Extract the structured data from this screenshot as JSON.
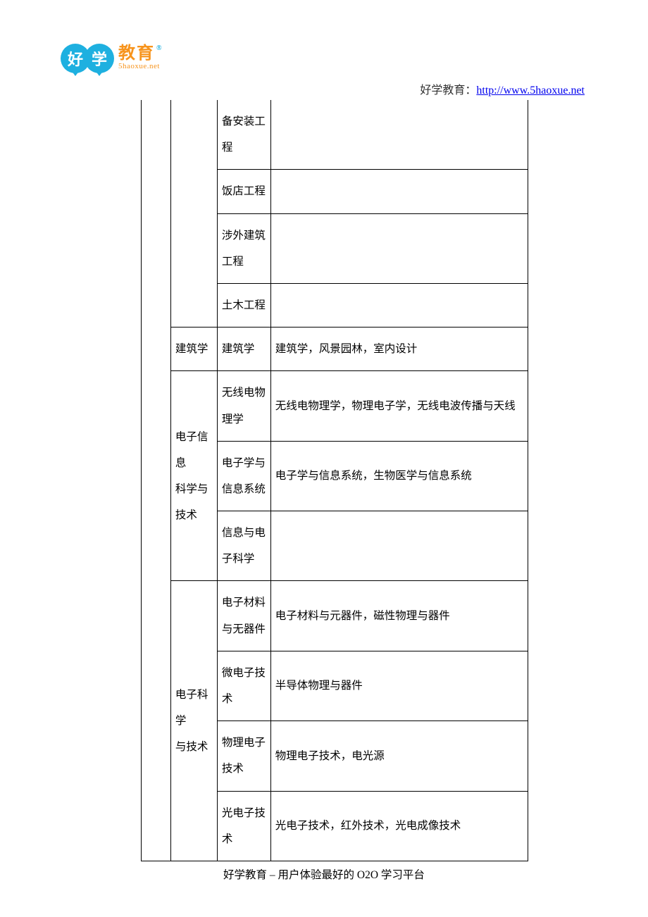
{
  "logo": {
    "char1": "好",
    "char2": "学",
    "edu_main": "教育",
    "reg": "®",
    "edu_sub": "5haoxue.net"
  },
  "header": {
    "label": "好学教育：",
    "url": "http://www.5haoxue.net"
  },
  "table": {
    "rows": [
      {
        "c3": "备安装工程",
        "c4": "",
        "c3_cont": true
      },
      {
        "c3": "饭店工程",
        "c4": ""
      },
      {
        "c3": "涉外建筑工程",
        "c4": ""
      },
      {
        "c3": "土木工程",
        "c4": ""
      },
      {
        "c2": "建筑学",
        "c3": "建筑学",
        "c4": "建筑学，风景园林，室内设计"
      },
      {
        "c2": "电子信息\n科学与\n技术",
        "c2_rowspan": 3,
        "c3": "无线电物理学",
        "c4": "无线电物理学，物理电子学，无线电波传播与天线"
      },
      {
        "c3": "电子学与信息系统",
        "c4": "电子学与信息系统，生物医学与信息系统"
      },
      {
        "c3": "信息与电子科学",
        "c4": ""
      },
      {
        "c2": "电子科学\n与技术",
        "c2_rowspan": 4,
        "c3": "电子材料与无器件",
        "c4": "电子材料与元器件，磁性物理与器件"
      },
      {
        "c3": "微电子技术",
        "c4": "半导体物理与器件"
      },
      {
        "c3": "物理电子技术",
        "c4": "物理电子技术，电光源"
      },
      {
        "c3": "光电子技术",
        "c4": "光电子技术，红外技术，光电成像技术"
      }
    ],
    "col2_group1": "电子信息\n科学与技术",
    "col2_group1_l1": "电子信",
    "col2_group1_l2": "息",
    "col2_group1_l3": "科学与",
    "col2_group1_l4": "技术",
    "col2_group2_l1": "电子科",
    "col2_group2_l2": "学",
    "col2_group2_l3": "与技术",
    "r1_c3": "备安装工程",
    "r2_c3": "饭店工程",
    "r3_c3": "涉外建筑工程",
    "r4_c3": "土木工程",
    "r5_c2": "建筑学",
    "r5_c3": "建筑学",
    "r5_c4": "建筑学，风景园林，室内设计",
    "r6_c3": "无线电物理学",
    "r6_c4": "无线电物理学，物理电子学，无线电波传播与天线",
    "r7_c3": "电子学与信息系统",
    "r7_c4": "电子学与信息系统，生物医学与信息系统",
    "r8_c3": "信息与电子科学",
    "r9_c3": "电子材料与无器件",
    "r9_c4": "电子材料与元器件，磁性物理与器件",
    "r10_c3": "微电子技术",
    "r10_c4": "半导体物理与器件",
    "r11_c3": "物理电子技术",
    "r11_c4": "物理电子技术，电光源",
    "r12_c3": "光电子技术",
    "r12_c4": "光电子技术，红外技术，光电成像技术"
  },
  "footer": {
    "text": "好学教育 – 用户体验最好的 O2O 学习平台"
  }
}
